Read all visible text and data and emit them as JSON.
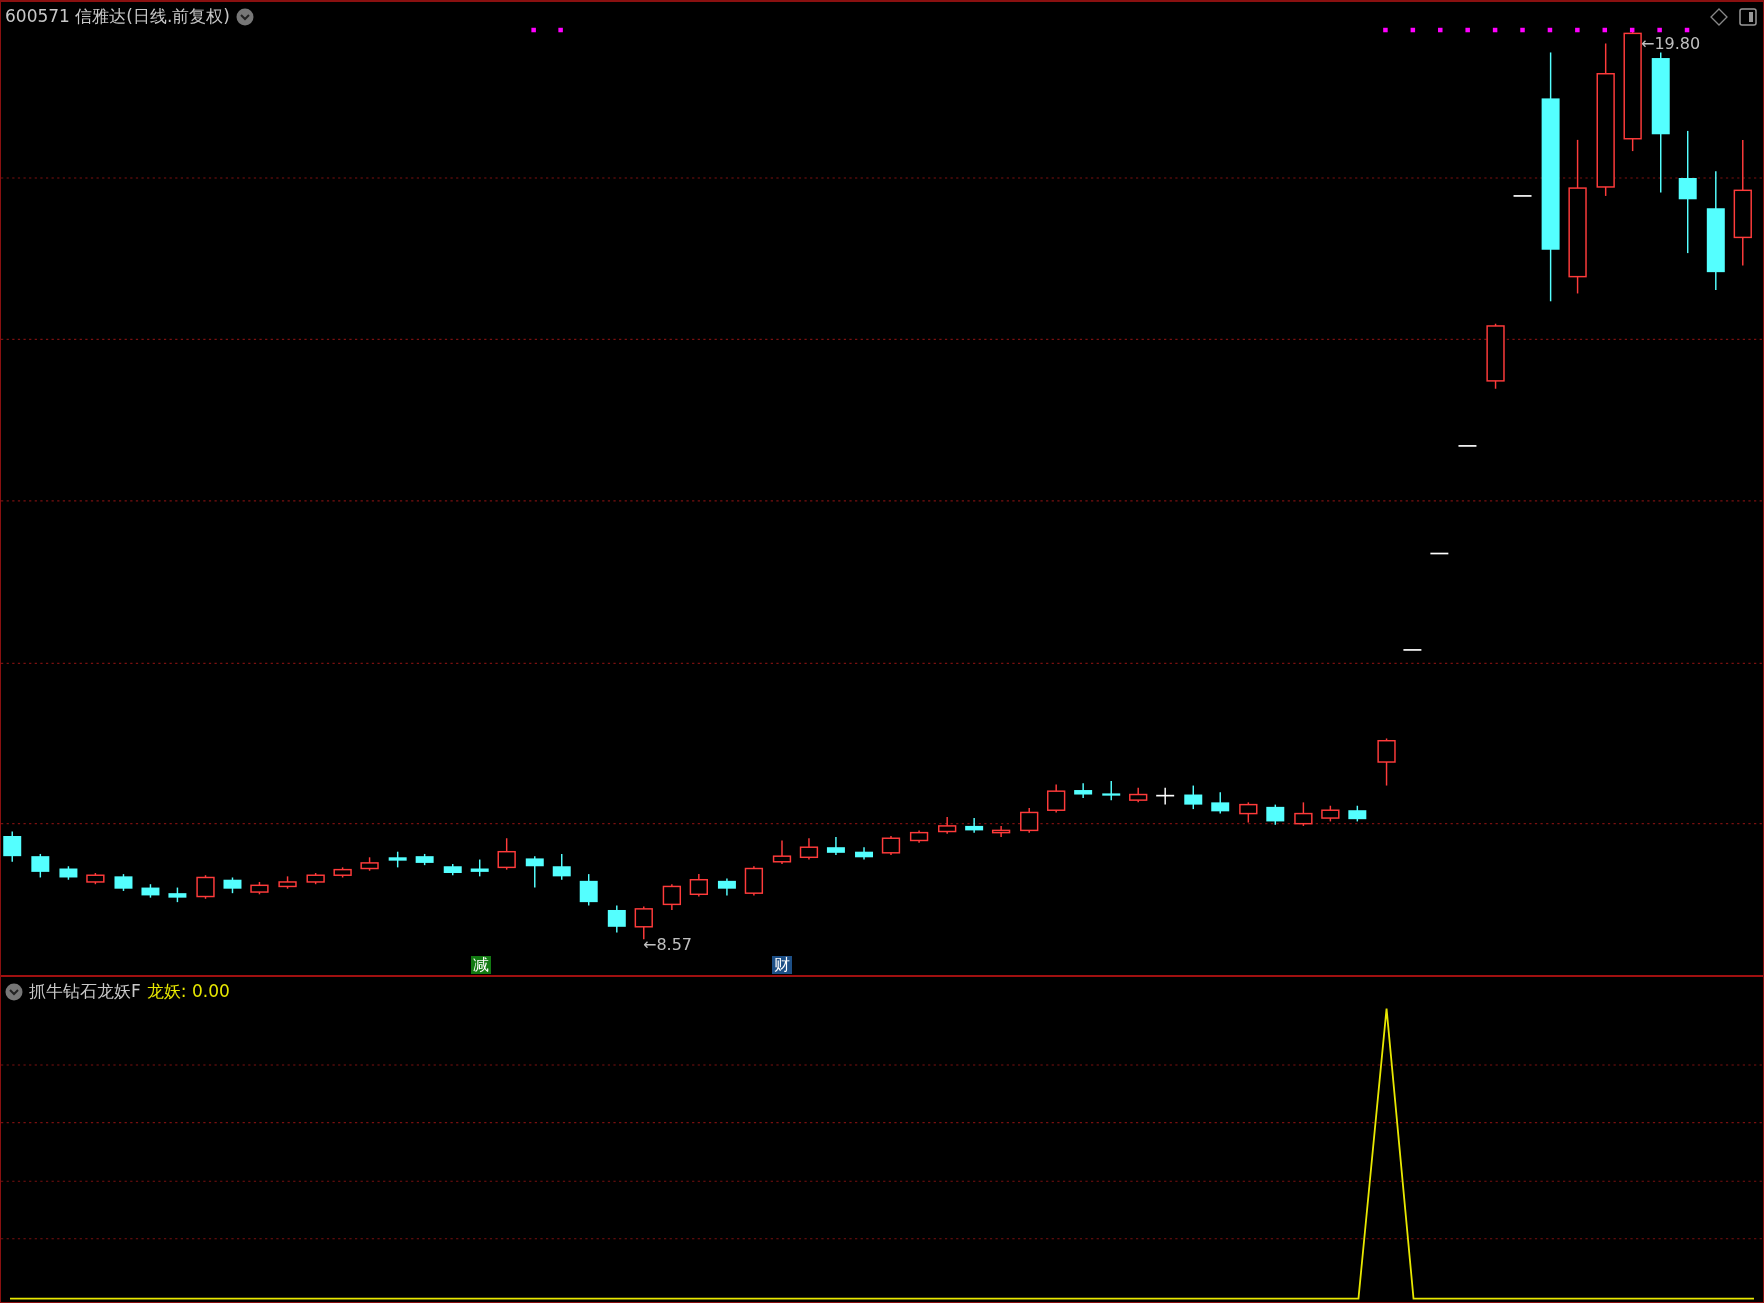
{
  "header": {
    "title": "600571 信雅达(日线.前复权)"
  },
  "price_chart": {
    "high_label": "←19.80",
    "low_label": "←8.57",
    "markers": [
      {
        "text": "减",
        "color": "#127a12"
      },
      {
        "text": "财",
        "color": "#1d4f86"
      }
    ]
  },
  "indicator": {
    "name": "抓牛钻石龙妖F",
    "value_label": "龙妖: 0.00"
  }
}
